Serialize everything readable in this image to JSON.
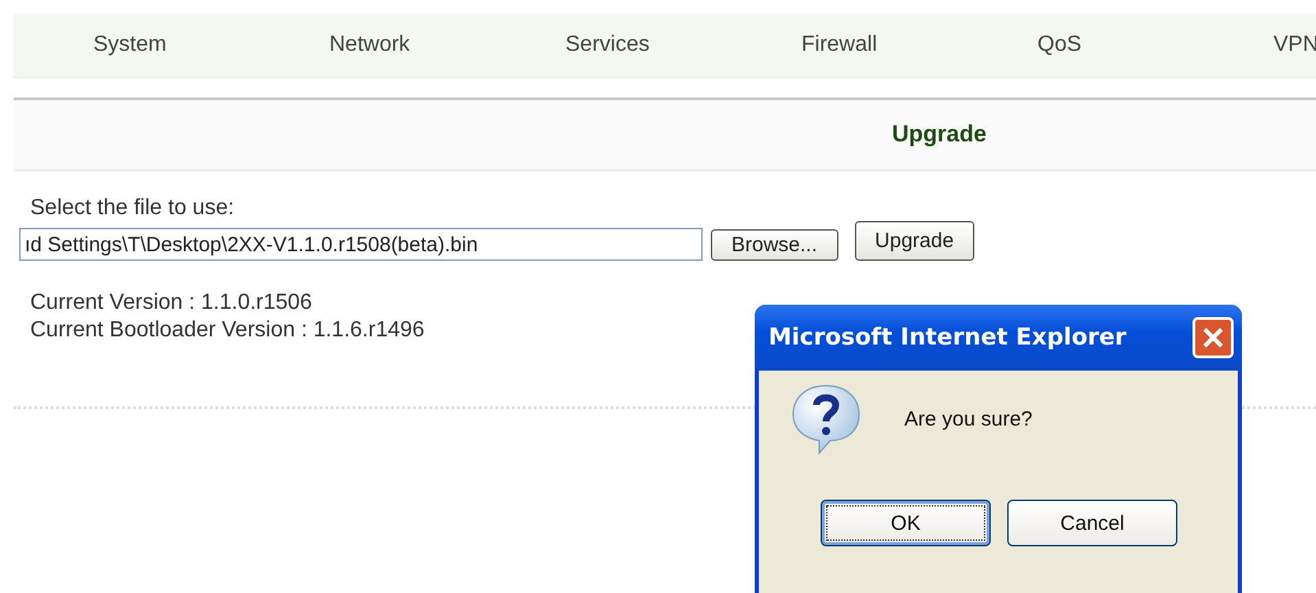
{
  "nav": {
    "items": [
      "System",
      "Network",
      "Services",
      "Firewall",
      "QoS",
      "VPN"
    ]
  },
  "section": {
    "title": "Upgrade"
  },
  "upload": {
    "label": "Select the file to use:",
    "file_value": "ıd Settings\\T\\Desktop\\2XX-V1.1.0.r1508(beta).bin",
    "browse_button": "Browse...",
    "upgrade_button": "Upgrade"
  },
  "versions": [
    "Current Version : 1.1.0.r1506",
    "Current Bootloader Version : 1.1.6.r1496"
  ],
  "dialog": {
    "title": "Microsoft Internet Explorer",
    "message": "Are you sure?",
    "buttons": [
      {
        "label": "OK",
        "focused": true
      },
      {
        "label": "Cancel",
        "focused": false
      }
    ]
  }
}
